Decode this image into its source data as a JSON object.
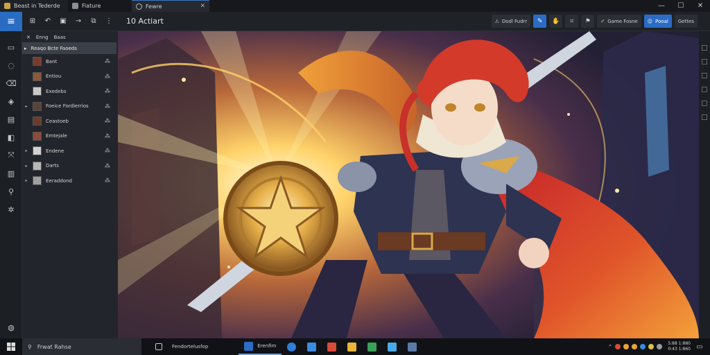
{
  "titlebar": {
    "app_tab": "Beast in Tederde",
    "file_tab": "Fiature",
    "doc_tab": "Fewre"
  },
  "toolbar": {
    "doc_title": "10 Actiart",
    "chip_dodl": "Dodl Fudrr",
    "chip_game": "Game Fosne",
    "chip_pooal": "Pooal",
    "chip_gettes": "Gettes"
  },
  "layers": {
    "header_a": "Enng",
    "header_b": "Baas",
    "group_label": "Reaqo Bcte Faoeds",
    "rows": [
      {
        "label": "Bant",
        "thumb": "#7a3b2e"
      },
      {
        "label": "Entiou",
        "thumb": "#8a5a3a"
      },
      {
        "label": "Exedebs",
        "thumb": "#c9c9c9"
      },
      {
        "label": "Foeice Fordierrios",
        "thumb": "#5a4336"
      },
      {
        "label": "Ceastoeb",
        "thumb": "#6b3b2b"
      },
      {
        "label": "Emtejale",
        "thumb": "#8e4a3b"
      },
      {
        "label": "Endene",
        "thumb": "#d2d2d2"
      },
      {
        "label": "Darts",
        "thumb": "#b8b8b8"
      },
      {
        "label": "Eeraddond",
        "thumb": "#a0a0a0"
      }
    ]
  },
  "taskbar": {
    "search_text": "Frwat Rahse",
    "app1": "Fendortelusfop",
    "app2": "Erenfim",
    "time": "5:88 1:880",
    "date": "0:43 1:860"
  }
}
